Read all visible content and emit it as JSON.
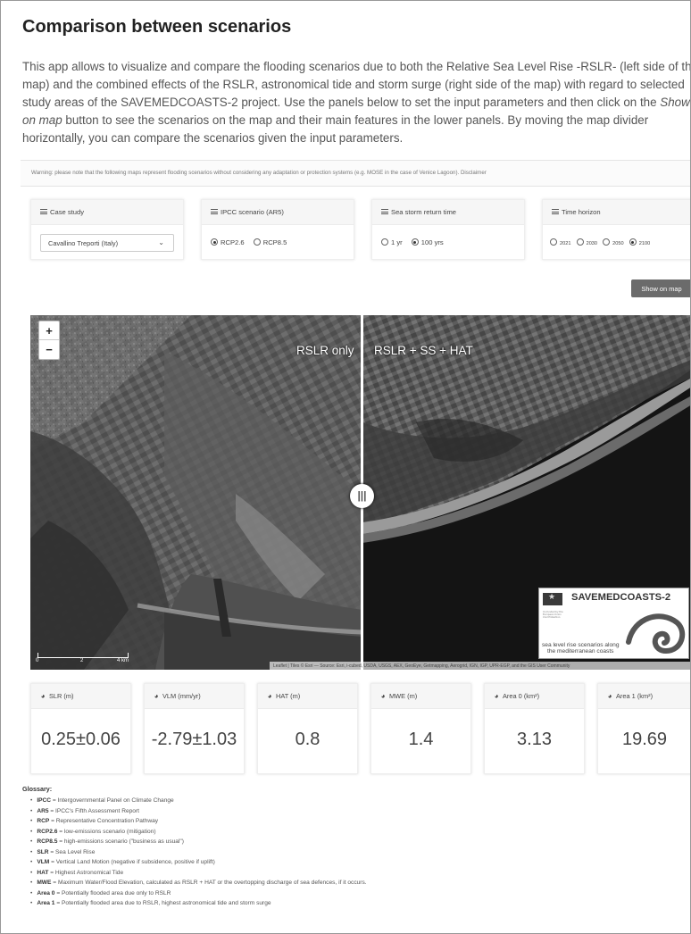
{
  "page": {
    "title": "Comparison between scenarios",
    "intro_part1": "This app allows to visualize and compare the flooding scenarios due to both the Relative Sea Level Rise -RSLR- (left side of the map) and the combined effects of the RSLR, astronomical tide and storm surge (right side of the map) with regard to selected study areas of the SAVEMEDCOASTS-2 project. Use the panels below to set the input parameters and then click on the ",
    "intro_em": "Show on map",
    "intro_part2": " button to see the scenarios on the map and their main features in the lower panels. By moving the map divider horizontally, you can compare the scenarios given the input parameters.",
    "warning": "Warning: please note that the following maps represent flooding scenarios without considering any adaptation or protection systems (e.g. MOSE in the case of Venice Lagoon). Disclaimer"
  },
  "panels": {
    "case_study": {
      "title": "Case study",
      "selected": "Cavallino Treporti (Italy)"
    },
    "ipcc": {
      "title": "IPCC scenario (AR5)",
      "options": [
        "RCP2.6",
        "RCP8.5"
      ],
      "selected_index": 0
    },
    "storm": {
      "title": "Sea storm return time",
      "options": [
        "1 yr",
        "100 yrs"
      ],
      "selected_index": 1
    },
    "horizon": {
      "title": "Time horizon",
      "options": [
        "2021",
        "2030",
        "2050",
        "2100"
      ],
      "selected_index": 3
    }
  },
  "show_button": "Show on map",
  "map": {
    "zoom_in": "+",
    "zoom_out": "−",
    "left_label": "RSLR only",
    "right_label": "RSLR + SS + HAT",
    "handle": "|||",
    "scale": [
      "0",
      "2",
      "4 km"
    ],
    "attribution": "Leaflet | Tiles © Esri — Source: Esri, i-cubed, USDA, USGS, AEX, GeoEye, Getmapping, Aerogrid, IGN, IGP, UPR-EGP, and the GIS User Community",
    "logo_title": "SAVEMEDCOASTS-2",
    "logo_sub": "Co-funded by the European Union Civil Protection",
    "logo_tagline_1": "sea level rise scenarios along",
    "logo_tagline_2": "the mediterranean coasts"
  },
  "metrics": [
    {
      "label": "SLR (m)",
      "value": "0.25±0.06"
    },
    {
      "label": "VLM (mm/yr)",
      "value": "-2.79±1.03"
    },
    {
      "label": "HAT (m)",
      "value": "0.8"
    },
    {
      "label": "MWE (m)",
      "value": "1.4"
    },
    {
      "label": "Area 0 (km²)",
      "value": "3.13"
    },
    {
      "label": "Area 1 (km²)",
      "value": "19.69"
    }
  ],
  "glossary": {
    "title": "Glossary:",
    "items": [
      {
        "term": "IPCC",
        "def": " = Intergovernmental Panel on Climate Change"
      },
      {
        "term": "AR5",
        "def": " = IPCC's Fifth Assessment Report"
      },
      {
        "term": "RCP",
        "def": " = Representative Concentration Pathway"
      },
      {
        "term": "RCP2.6",
        "def": " = low-emissions scenario (mitigation)"
      },
      {
        "term": "RCP8.5",
        "def": " = high-emissions scenario (\"business as usual\")"
      },
      {
        "term": "SLR",
        "def": " = Sea Level Rise"
      },
      {
        "term": "VLM",
        "def": " = Vertical Land Motion (negative if subsidence, positive if uplift)"
      },
      {
        "term": "HAT",
        "def": " = Highest Astronomical Tide"
      },
      {
        "term": "MWE",
        "def": " = Maximum Water/Flood Elevation, calculated as RSLR + HAT or the overtopping discharge of sea defences, if it occurs."
      },
      {
        "term": "Area 0",
        "def": " = Potentially flooded area due only to RSLR"
      },
      {
        "term": "Area 1",
        "def": " = Potentially flooded area due to RSLR, highest astronomical tide and storm surge"
      }
    ]
  }
}
